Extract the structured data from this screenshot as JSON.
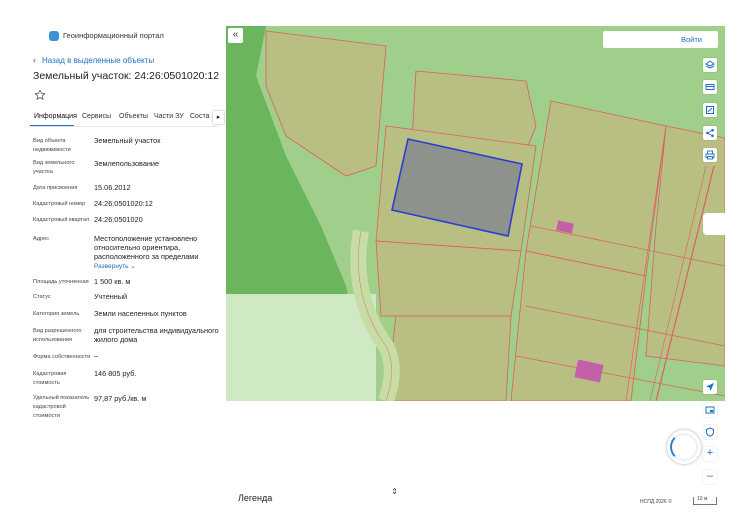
{
  "header": {
    "logo_icon": "globe-logo-icon",
    "portal_name": "Геоинформационный портал"
  },
  "nav": {
    "back_label": "Назад в выделенные объекты"
  },
  "object": {
    "title": "Земельный участок: 24:26:0501020:12"
  },
  "tabs": [
    {
      "label": "Информация",
      "active": true
    },
    {
      "label": "Сервисы",
      "active": false
    },
    {
      "label": "Объекты",
      "active": false
    },
    {
      "label": "Части ЗУ",
      "active": false
    },
    {
      "label": "Соста",
      "active": false
    }
  ],
  "properties": [
    {
      "label": "Вид объекта недвижимости",
      "value": "Земельный участок"
    },
    {
      "label": "Вид земельного участка",
      "value": "Землепользование"
    },
    {
      "label": "Дата присвоения",
      "value": "15.06.2012"
    },
    {
      "label": "Кадастровый номер",
      "value": "24:26:0501020:12"
    },
    {
      "label": "Кадастровый квартал",
      "value": "24:26:0501020"
    },
    {
      "label": "Адрес",
      "value": "Местоположение установлено относительно ориентира, расположенного за пределами"
    },
    {
      "label": "Площадь уточненная",
      "value": "1 500 кв. м"
    },
    {
      "label": "Статус",
      "value": "Учтенный"
    },
    {
      "label": "Категория земель",
      "value": "Земли населенных пунктов"
    },
    {
      "label": "Вид разрешенного использования",
      "value": "для строительства индивидуального жилого дома"
    },
    {
      "label": "Форма собственности",
      "value": "–"
    },
    {
      "label": "Кадастровая стоимость",
      "value": "146 805 руб."
    },
    {
      "label": "Удельный показатель кадастровой стоимости",
      "value": "97,87 руб./кв. м"
    }
  ],
  "expand_label": "Развернуть",
  "map": {
    "login_label": "Войти",
    "tools": [
      "layers-icon",
      "card-icon",
      "measure-icon",
      "share-icon",
      "print-icon"
    ],
    "bottom_tools": [
      "locate-icon",
      "minimap-icon",
      "shield-icon",
      "zoom-in-icon",
      "zoom-out-icon"
    ],
    "zoom_in": "+",
    "zoom_out": "–",
    "colors": {
      "forest": "#6bb55c",
      "meadow": "#9fcf8a",
      "parcel_fill": "#b9bf83",
      "parcel_stroke": "#e05d5d",
      "selected_fill": "#8a8d8d",
      "selected_stroke": "#2a3fd1",
      "building": "#c35fa9"
    }
  },
  "legend": {
    "label": "Легенда"
  },
  "footer": {
    "copyright": "НСПД 2026 ©",
    "scale_label": "10 м"
  }
}
